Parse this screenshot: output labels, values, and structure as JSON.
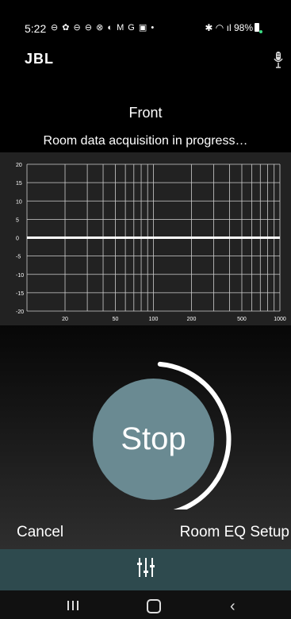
{
  "status_bar": {
    "time": "5:22",
    "notification_icons": "⊖ ✿ ⊖ ⊖ ⊗ ◐ M G ▣ •",
    "right_icons": "✱ ◠ ıl",
    "battery": "98%"
  },
  "header": {
    "logo": "JBL",
    "mic_icon": "microphone-icon"
  },
  "title": "Front",
  "subtitle": "Room data acquisition in progress…",
  "chart_data": {
    "type": "line",
    "x_scale": "log",
    "xlim": [
      10,
      1000
    ],
    "ylim": [
      -20,
      20
    ],
    "x_ticks": [
      "20",
      "50",
      "100",
      "200",
      "500",
      "1000"
    ],
    "y_ticks": [
      "20",
      "15",
      "10",
      "5",
      "0",
      "-5",
      "-10",
      "-15",
      "-20"
    ],
    "grid": true,
    "series": [
      {
        "x": [
          10,
          1000
        ],
        "y": [
          0,
          0
        ]
      }
    ]
  },
  "stop_button": {
    "label": "Stop"
  },
  "progress": {
    "fraction": 0.45
  },
  "footer": {
    "cancel_label": "Cancel",
    "room_eq_label": "Room EQ Setup"
  },
  "bottom_bar": {
    "icon": "equalizer-icon"
  },
  "nav": {
    "recents_icon": "recents-icon",
    "home_icon": "home-icon",
    "back_icon": "back-icon"
  },
  "colors": {
    "stop_fill": "#6a8a92",
    "bottom_bar": "#2e4a4e",
    "chart_bg": "#222222"
  }
}
